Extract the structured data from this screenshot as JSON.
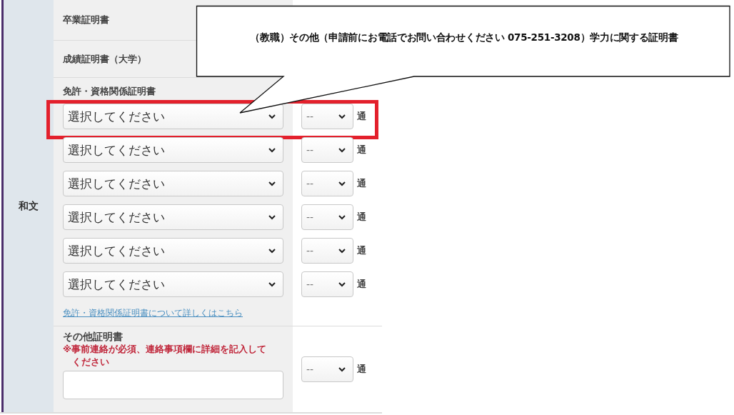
{
  "side_label": "和文",
  "rows": [
    {
      "kind": "plain",
      "label": "卒業証明書"
    },
    {
      "kind": "plain",
      "label": "成績証明書（大学）"
    },
    {
      "kind": "selects",
      "label": "免許・資格関係証明書",
      "selects": [
        {
          "value": "選択してください",
          "count": "--",
          "unit": "通",
          "highlighted": true
        },
        {
          "value": "選択してください",
          "count": "--",
          "unit": "通",
          "highlighted": false
        },
        {
          "value": "選択してください",
          "count": "--",
          "unit": "通",
          "highlighted": false
        },
        {
          "value": "選択してください",
          "count": "--",
          "unit": "通",
          "highlighted": false
        },
        {
          "value": "選択してください",
          "count": "--",
          "unit": "通",
          "highlighted": false
        },
        {
          "value": "選択してください",
          "count": "--",
          "unit": "通",
          "highlighted": false
        }
      ],
      "link": "免許・資格関係証明書について詳しくはこちら"
    },
    {
      "kind": "other",
      "label": "その他証明書",
      "note": "※事前連絡が必須、連絡事項欄に詳細を記入してください",
      "count": "--",
      "unit": "通"
    }
  ],
  "callout": {
    "text": "（教職）その他（申請前にお電話でお問い合わせください 075-251-3208）学力に関する証明書"
  }
}
